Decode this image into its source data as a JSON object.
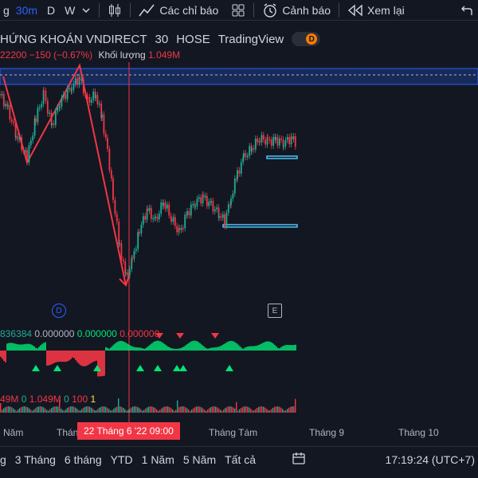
{
  "toolbar": {
    "intervals": [
      "g",
      "30m",
      "D",
      "W"
    ],
    "active_interval": "30m",
    "indicators_label": "Các chỉ báo",
    "alerts_label": "Cảnh báo",
    "replay_label": "Xem lại"
  },
  "symbol": {
    "name": "HỨNG KHOÁN VNDIRECT",
    "interval": "30",
    "exchange": "HOSE",
    "source": "TradingView",
    "badge": "D"
  },
  "quote": {
    "price": "22200",
    "change": "−150 (−0.67%)",
    "volume_label": "Khối lượng",
    "volume_value": "1.049M"
  },
  "indicator1": {
    "values": [
      "836384",
      "0.000000",
      "0.000000",
      "0.000000"
    ]
  },
  "indicator2": {
    "values": [
      "49M",
      "0",
      "1.049M",
      "0",
      "100",
      "1"
    ]
  },
  "markers": {
    "d_label": "D",
    "e_label": "E"
  },
  "time_axis": {
    "labels": [
      "Năm",
      "Thán",
      "Tháng Tám",
      "Tháng 9",
      "Tháng 10"
    ],
    "cursor": "22 Tháng 6 '22   09:00"
  },
  "bottom_bar": {
    "ranges": [
      "g",
      "3 Tháng",
      "6 tháng",
      "YTD",
      "1 Năm",
      "5 Năm",
      "Tất cả"
    ],
    "clock": "17:19:24 (UTC+7)"
  },
  "colors": {
    "background": "#131722",
    "up": "#22ab94",
    "down": "#f23645",
    "accent": "#2962ff",
    "osc_green": "#00e676"
  }
}
